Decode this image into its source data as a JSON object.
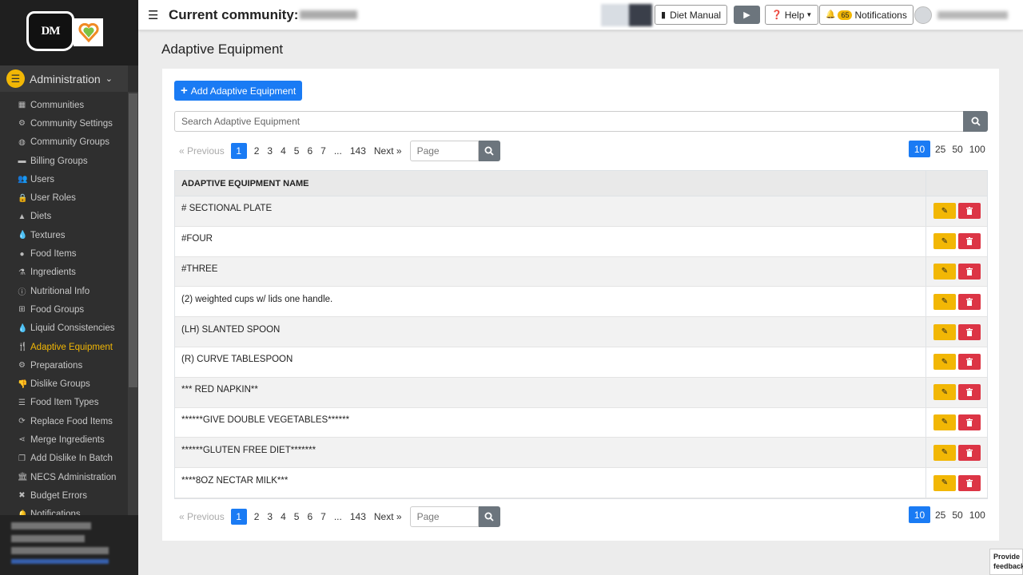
{
  "sidebar": {
    "logo_text": "DM",
    "section_label": "Administration",
    "items": [
      {
        "label": "Communities",
        "icon": "building-icon",
        "glyph": "▦"
      },
      {
        "label": "Community Settings",
        "icon": "gear-icon",
        "glyph": "⚙"
      },
      {
        "label": "Community Groups",
        "icon": "globe-icon",
        "glyph": "◍"
      },
      {
        "label": "Billing Groups",
        "icon": "money-icon",
        "glyph": "▬"
      },
      {
        "label": "Users",
        "icon": "users-icon",
        "glyph": "👥"
      },
      {
        "label": "User Roles",
        "icon": "lock-icon",
        "glyph": "🔒"
      },
      {
        "label": "Diets",
        "icon": "warning-icon",
        "glyph": "▲"
      },
      {
        "label": "Textures",
        "icon": "drop-icon",
        "glyph": "💧"
      },
      {
        "label": "Food Items",
        "icon": "apple-icon",
        "glyph": "●"
      },
      {
        "label": "Ingredients",
        "icon": "flask-icon",
        "glyph": "⚗"
      },
      {
        "label": "Nutritional Info",
        "icon": "info-icon",
        "glyph": "ⓘ"
      },
      {
        "label": "Food Groups",
        "icon": "sitemap-icon",
        "glyph": "⊞"
      },
      {
        "label": "Liquid Consistencies",
        "icon": "drop-icon",
        "glyph": "💧"
      },
      {
        "label": "Adaptive Equipment",
        "icon": "utensils-icon",
        "glyph": "🍴"
      },
      {
        "label": "Preparations",
        "icon": "cogs-icon",
        "glyph": "⚙"
      },
      {
        "label": "Dislike Groups",
        "icon": "thumbs-down-icon",
        "glyph": "👎"
      },
      {
        "label": "Food Item Types",
        "icon": "list-icon",
        "glyph": "☰"
      },
      {
        "label": "Replace Food Items",
        "icon": "sync-icon",
        "glyph": "⟳"
      },
      {
        "label": "Merge Ingredients",
        "icon": "share-icon",
        "glyph": "⋖"
      },
      {
        "label": "Add Dislike In Batch",
        "icon": "copy-icon",
        "glyph": "❐"
      },
      {
        "label": "NECS Administration",
        "icon": "bank-icon",
        "glyph": "🏛"
      },
      {
        "label": "Budget Errors",
        "icon": "error-icon",
        "glyph": "✖"
      },
      {
        "label": "Notifications",
        "icon": "bell-icon",
        "glyph": "🔔"
      }
    ],
    "active_index": 13
  },
  "topbar": {
    "title": "Current community:",
    "diet_manual_label": "Diet Manual",
    "help_label": "Help",
    "notification_count": "65",
    "notifications_label": "Notifications"
  },
  "page": {
    "title": "Adaptive Equipment",
    "add_button_label": "Add Adaptive Equipment",
    "search_placeholder": "Search Adaptive Equipment"
  },
  "pagination": {
    "previous_label": "« Previous",
    "pages": [
      "2",
      "3",
      "4",
      "5",
      "6",
      "7",
      "..."
    ],
    "current_page": "1",
    "last_page": "143",
    "next_label": "Next »",
    "page_input_placeholder": "Page",
    "page_sizes": [
      "25",
      "50",
      "100"
    ],
    "current_page_size": "10"
  },
  "table": {
    "header": "ADAPTIVE EQUIPMENT NAME",
    "rows": [
      "# SECTIONAL PLATE",
      "#FOUR",
      "#THREE",
      "(2) weighted cups w/ lids one handle.",
      "(LH) SLANTED SPOON",
      "(R) CURVE TABLESPOON",
      "*** RED NAPKIN**",
      "******GIVE DOUBLE VEGETABLES******",
      "******GLUTEN FREE DIET*******",
      "****8OZ NECTAR MILK***"
    ]
  },
  "feedback_label": "Provide feedback",
  "colors": {
    "primary": "#1a7bf4",
    "accent": "#f2b705",
    "danger": "#dc3545",
    "sidebar_bg": "#2f2f2f"
  }
}
